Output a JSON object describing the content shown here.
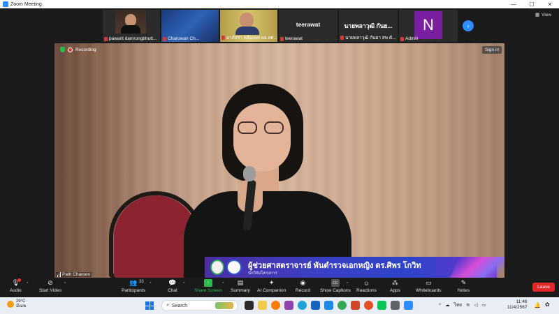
{
  "window": {
    "title": "Zoom Meeting"
  },
  "gallery": {
    "participants": [
      {
        "name": "pawarit damrongbhutt..."
      },
      {
        "name": "Charuwan Ch..."
      },
      {
        "name": "อาภัสรา หลิมเพท ผอ.สศ..."
      },
      {
        "name": "teerawat",
        "label": "teerawat"
      },
      {
        "name": "นายพลาวุฒิ กันยา สพ ดั...",
        "label": "นายพลาวุฒิ กันย..."
      },
      {
        "name": "Admin",
        "initial": "N"
      }
    ],
    "view_label": "View"
  },
  "stage": {
    "recording_label": "Recording",
    "signin_label": "Sign in",
    "speaker_name": "Path Charoen",
    "lower_third_title": "ผู้ช่วยศาสตราจารย์ พันตำรวจเอกหญิง ดร.ศิพร โกวิท",
    "lower_third_subtitle": "นักวิจัยโครงการ"
  },
  "toolbar": {
    "audio": "Audio",
    "start_video": "Start Video",
    "participants": "Participants",
    "participants_count": "33",
    "chat": "Chat",
    "share_screen": "Share Screen",
    "summary": "Summary",
    "ai_companion": "AI Companion",
    "record": "Record",
    "show_captions": "Show Captions",
    "reactions": "Reactions",
    "apps": "Apps",
    "whiteboards": "Whiteboards",
    "notes": "Notes",
    "leave": "Leave"
  },
  "taskbar": {
    "temperature": "29°C",
    "weather_desc": "มีเมฆ",
    "search_placeholder": "Search",
    "lang": "ไทย",
    "time": "11:48",
    "date": "11/4/2567"
  },
  "colors": {
    "accent": "#2d8cff",
    "share_green": "#2db84c",
    "leave_red": "#e02828",
    "lower_third": "#3b3fc4"
  }
}
